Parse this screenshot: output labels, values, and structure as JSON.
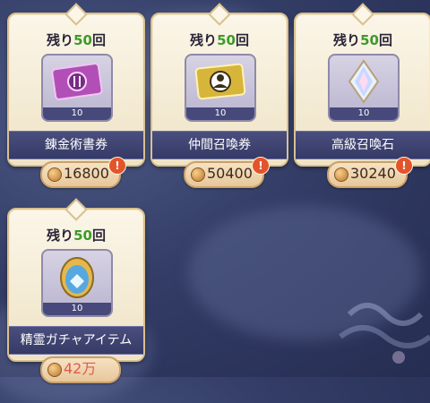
{
  "cards": [
    {
      "remain_prefix": "残り",
      "remain_num": "50",
      "remain_suffix": "回",
      "count": "10",
      "name": "錬金術書券",
      "price": "16800",
      "has_alert": true
    },
    {
      "remain_prefix": "残り",
      "remain_num": "50",
      "remain_suffix": "回",
      "count": "10",
      "name": "仲間召喚券",
      "price": "50400",
      "has_alert": true
    },
    {
      "remain_prefix": "残り",
      "remain_num": "50",
      "remain_suffix": "回",
      "count": "10",
      "name": "高級召喚石",
      "price": "30240",
      "has_alert": true
    },
    {
      "remain_prefix": "残り",
      "remain_num": "50",
      "remain_suffix": "回",
      "count": "10",
      "name": "精霊ガチャアイテム",
      "price": "42万",
      "has_alert": false
    }
  ],
  "alert_mark": "!",
  "icons": [
    "alchemy-ticket-icon",
    "ally-ticket-icon",
    "crystal-icon",
    "spirit-egg-icon",
    "coin-icon"
  ],
  "colors": {
    "remain_num": "#3c9a2a",
    "price_unaffordable": "#e05a4d",
    "alert": "#e2542c"
  }
}
